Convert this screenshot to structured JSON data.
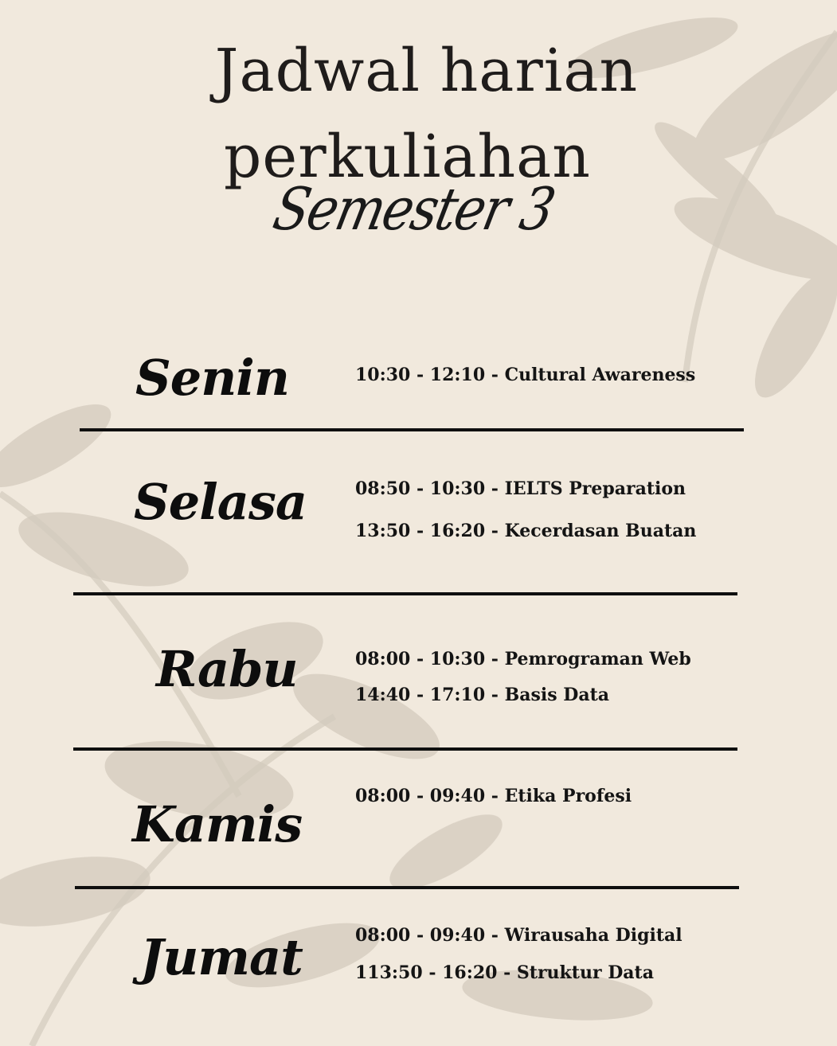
{
  "title": {
    "line1": "Jadwal harian",
    "line2": "perkuliahan",
    "subtitle": "Semester 3"
  },
  "schedule": [
    {
      "day": "Senin",
      "entries": [
        "10:30 - 12:10 - Cultural Awareness"
      ]
    },
    {
      "day": "Selasa",
      "entries": [
        "08:50 - 10:30 - IELTS Preparation",
        "13:50 - 16:20 - Kecerdasan Buatan"
      ]
    },
    {
      "day": "Rabu",
      "entries": [
        "08:00 - 10:30 - Pemrograman Web",
        "14:40 - 17:10 - Basis Data"
      ]
    },
    {
      "day": "Kamis",
      "entries": [
        "08:00 - 09:40 - Etika Profesi"
      ]
    },
    {
      "day": "Jumat",
      "entries": [
        "08:00 - 09:40 - Wirausaha Digital",
        "113:50 - 16:20 - Struktur Data"
      ]
    }
  ],
  "colors": {
    "background": "#f1e9dd",
    "text": "#141414",
    "shadow": "#cfc6b9"
  }
}
